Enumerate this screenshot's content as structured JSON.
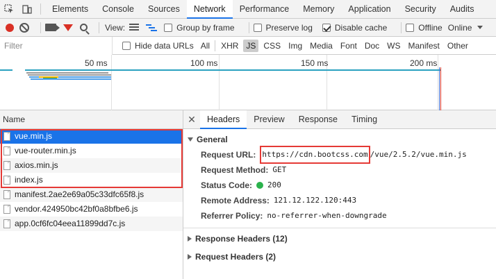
{
  "tabs": [
    "Elements",
    "Console",
    "Sources",
    "Network",
    "Performance",
    "Memory",
    "Application",
    "Security",
    "Audits"
  ],
  "active_tab": "Network",
  "toolbar": {
    "view_label": "View:",
    "group_by_frame": "Group by frame",
    "preserve_log": "Preserve log",
    "disable_cache": "Disable cache",
    "offline": "Offline",
    "throttle": "Online"
  },
  "filter": {
    "placeholder": "Filter",
    "hide_data_urls": "Hide data URLs",
    "types": [
      "All",
      "XHR",
      "JS",
      "CSS",
      "Img",
      "Media",
      "Font",
      "Doc",
      "WS",
      "Manifest",
      "Other"
    ],
    "active_type": "JS"
  },
  "overview": {
    "ticks": [
      "50 ms",
      "100 ms",
      "150 ms",
      "200 ms"
    ]
  },
  "list": {
    "header": "Name",
    "files": [
      "vue.min.js",
      "vue-router.min.js",
      "axios.min.js",
      "index.js",
      "manifest.2ae2e69a05c33dfc65f8.js",
      "vendor.424950bc42bf0a8bfbe6.js",
      "app.0cf6fc04eea11899dd7c.js"
    ]
  },
  "details": {
    "tabs": [
      "Headers",
      "Preview",
      "Response",
      "Timing"
    ],
    "active_tab": "Headers",
    "general_title": "General",
    "request_url_key": "Request URL:",
    "request_url_host": "https://cdn.bootcss.com",
    "request_url_path": "/vue/2.5.2/vue.min.js",
    "request_method_key": "Request Method:",
    "request_method": "GET",
    "status_code_key": "Status Code:",
    "status_code": "200",
    "remote_address_key": "Remote Address:",
    "remote_address": "121.12.122.120:443",
    "referrer_policy_key": "Referrer Policy:",
    "referrer_policy": "no-referrer-when-downgrade",
    "response_headers": "Response Headers (12)",
    "request_headers": "Request Headers (2)"
  }
}
